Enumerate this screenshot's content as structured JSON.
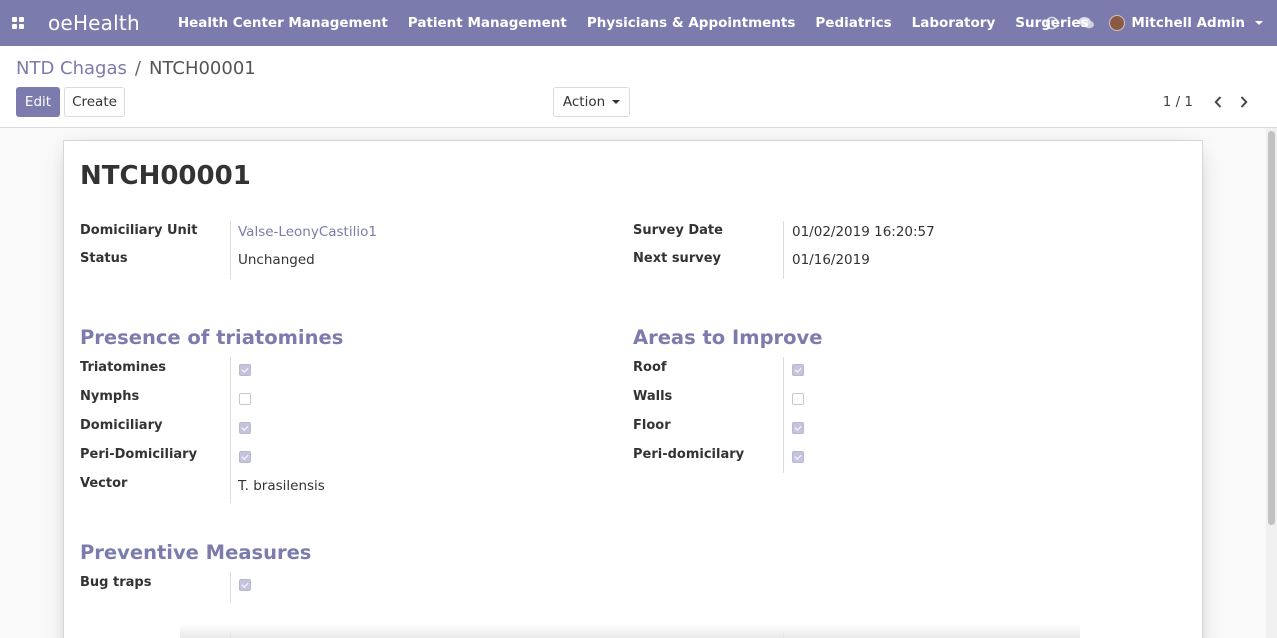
{
  "navbar": {
    "brand": "oeHealth",
    "menu": [
      "Health Center Management",
      "Patient Management",
      "Physicians & Appointments",
      "Pediatrics",
      "Laboratory",
      "Surgeries"
    ],
    "plus": "+",
    "user": "Mitchell Admin",
    "icons": [
      "apps-icon",
      "clock-icon",
      "chat-icon",
      "avatar",
      "chevron-down-icon"
    ]
  },
  "breadcrumb": {
    "parent": "NTD Chagas",
    "separator": "/",
    "current": "NTCH00001"
  },
  "toolbar": {
    "edit_label": "Edit",
    "create_label": "Create",
    "action_label": "Action"
  },
  "pager": {
    "value": "1 / 1"
  },
  "form": {
    "title": "NTCH00001",
    "domiciliary_unit": {
      "label": "Domiciliary Unit",
      "value": "Valse-LeonyCastilio1"
    },
    "status": {
      "label": "Status",
      "value": "Unchanged"
    },
    "survey_date": {
      "label": "Survey Date",
      "value": "01/02/2019 16:20:57"
    },
    "next_survey": {
      "label": "Next survey",
      "value": "01/16/2019"
    },
    "presence": {
      "title": "Presence of triatomines",
      "triatomines": {
        "label": "Triatomines",
        "checked": true
      },
      "nymphs": {
        "label": "Nymphs",
        "checked": false
      },
      "domiciliary": {
        "label": "Domiciliary",
        "checked": true
      },
      "peri_domiciliary": {
        "label": "Peri-Domiciliary",
        "checked": true
      },
      "vector": {
        "label": "Vector",
        "value": "T. brasilensis"
      }
    },
    "areas": {
      "title": "Areas to Improve",
      "roof": {
        "label": "Roof",
        "checked": true
      },
      "walls": {
        "label": "Walls",
        "checked": false
      },
      "floor": {
        "label": "Floor",
        "checked": true
      },
      "peri_domicilary": {
        "label": "Peri-domicilary",
        "checked": true
      }
    },
    "preventive": {
      "title": "Preventive Measures",
      "bug_traps": {
        "label": "Bug traps",
        "checked": true
      }
    }
  },
  "colors": {
    "brand": "#7c7bad",
    "checkbox_checked": "#c5c4dc"
  }
}
